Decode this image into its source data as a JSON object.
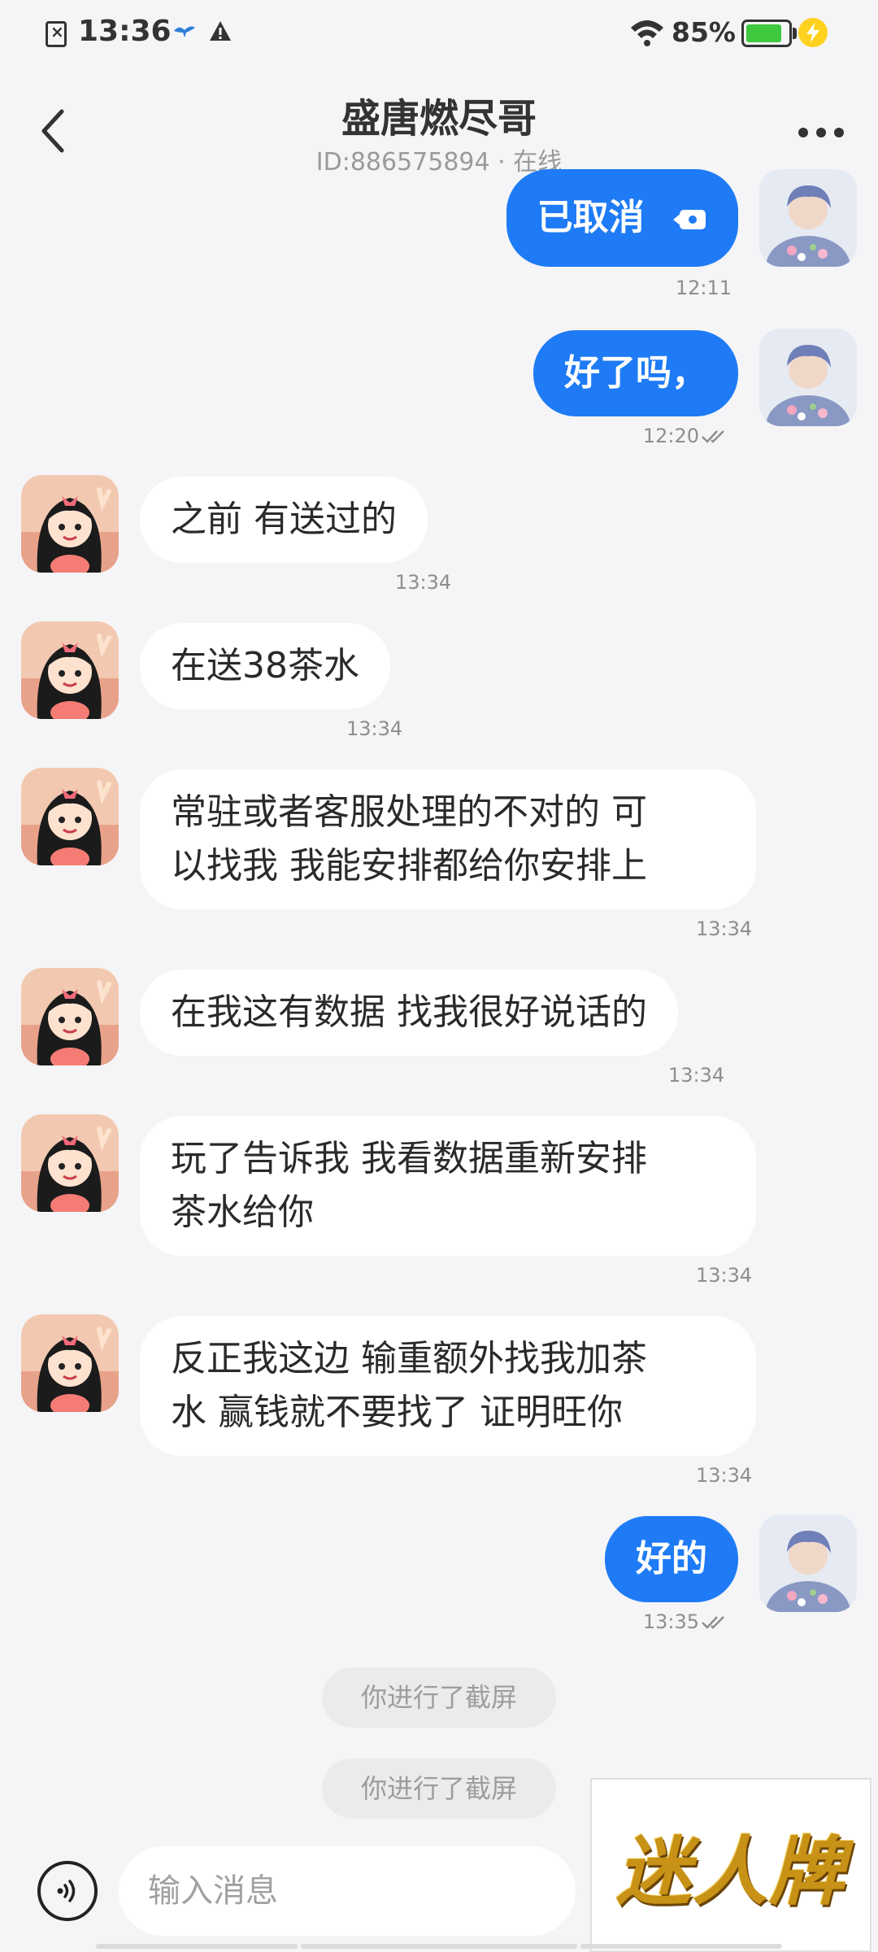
{
  "status_bar": {
    "time": "13:36",
    "battery_percent": "85%",
    "battery_level": 0.85,
    "icons": [
      "sim-error-icon",
      "bird-notification-icon",
      "warning-icon",
      "wifi-icon",
      "battery-icon",
      "charging-icon"
    ]
  },
  "header": {
    "title": "盛唐燃尽哥",
    "subtitle": "ID:886575894 · 在线"
  },
  "messages": [
    {
      "dir": "out",
      "text": "已取消",
      "icon": "video-call-icon",
      "time": "12:11"
    },
    {
      "dir": "out",
      "text": "好了吗，",
      "time": "12:20",
      "read": true
    },
    {
      "dir": "in",
      "text": "之前  有送过的",
      "time": "13:34"
    },
    {
      "dir": "in",
      "text": "在送38茶水",
      "time": "13:34"
    },
    {
      "dir": "in",
      "line1": "常驻或者客服处理的不对的 可",
      "line2": "以找我 我能安排都给你安排上",
      "time": "13:34"
    },
    {
      "dir": "in",
      "text": "在我这有数据  找我很好说话的",
      "time": "13:34"
    },
    {
      "dir": "in",
      "line1": "玩了告诉我  我看数据重新安排",
      "line2": "茶水给你",
      "time": "13:34"
    },
    {
      "dir": "in",
      "line1": "反正我这边 输重额外找我加茶",
      "line2": "水 赢钱就不要找了 证明旺你",
      "time": "13:34"
    },
    {
      "dir": "out",
      "text": "好的",
      "time": "13:35",
      "read": true
    }
  ],
  "system_notices": [
    "你进行了截屏",
    "你进行了截屏"
  ],
  "input": {
    "placeholder": "输入消息"
  },
  "watermark": {
    "text": "迷人牌"
  },
  "colors": {
    "outgoing_bubble": "#1e7bf5",
    "incoming_bubble": "#ffffff",
    "background": "#f5f5f7",
    "battery": "#3ec93e"
  }
}
